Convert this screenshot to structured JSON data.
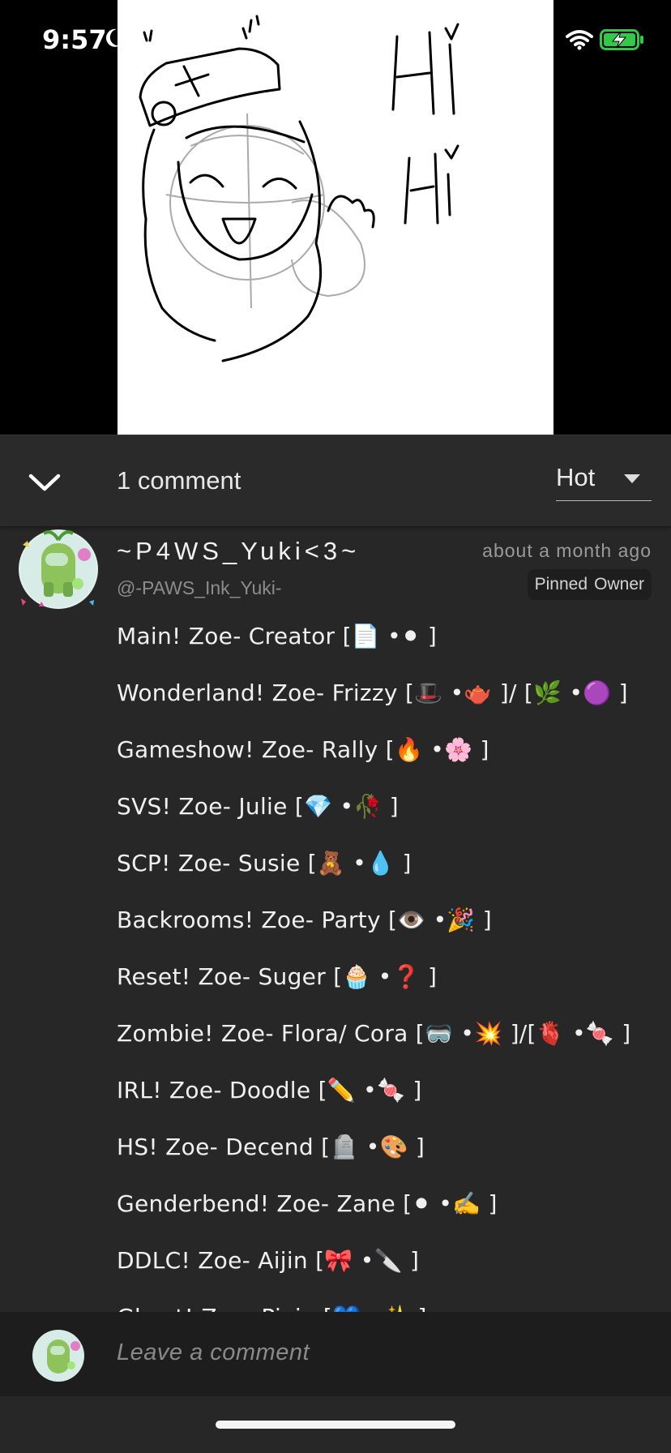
{
  "status": {
    "time": "9:57"
  },
  "header": {
    "comment_count": "1 comment",
    "sort_label": "Hot"
  },
  "comment": {
    "author": "~P4WS_Yuki<3~",
    "handle": "@-PAWS_Ink_Yuki-",
    "time": "about a month ago",
    "tags": [
      "Pinned",
      "Owner"
    ],
    "lines": [
      "Main! Zoe- Creator [📄 •⚫ ]",
      "Wonderland! Zoe- Frizzy [🎩 •🫖 ]/ [🌿 •🟣 ]",
      "Gameshow! Zoe- Rally [🔥 •🌸 ]",
      "SVS! Zoe- Julie [💎 •🥀 ]",
      "SCP! Zoe- Susie [🧸 •💧 ]",
      "Backrooms! Zoe- Party [👁️ •🎉 ]",
      "Reset! Zoe- Suger [🧁 •❓ ]",
      "Zombie! Zoe- Flora/ Cora [🥽 •💥 ]/[🫀 •🍬 ]",
      "IRL! Zoe- Doodle [✏️ •🍬 ]",
      "HS! Zoe- Decend [🪦 •🎨 ]",
      "Genderbend! Zoe- Zane [⚫ •✍️ ]",
      "DDLC! Zoe- Aijin [🎀 •🔪 ]",
      "Ghost! Zoe- Pixie [💙 •✨ ]"
    ]
  },
  "composer": {
    "placeholder": "Leave a comment"
  },
  "drawing": {
    "text_1": "Hi",
    "text_2": "Hi"
  },
  "colors": {
    "panel": "#272727",
    "header": "#2a2a2a",
    "composer": "#1d1d1d",
    "avatar_green": "#8dc35a"
  },
  "icons": [
    "moon-icon",
    "wifi-icon",
    "battery-charging-icon",
    "chevron-down-icon",
    "sort-caret-icon"
  ]
}
